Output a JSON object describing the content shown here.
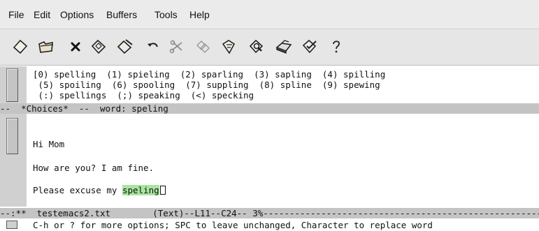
{
  "menubar": {
    "items": [
      "File",
      "Edit",
      "Options",
      "Buffers",
      "Tools",
      "Help"
    ]
  },
  "toolbar": {
    "icons": [
      "new-file-icon",
      "open-folder-icon",
      "close-icon",
      "save-icon",
      "save-as-icon",
      "undo-icon",
      "cut-icon",
      "copy-icon",
      "paste-icon",
      "search-icon",
      "print-icon",
      "spell-check-icon",
      "help-icon"
    ]
  },
  "choices": {
    "lines": [
      "[0) spelling  (1) spieling  (2) sparling  (3) sapling  (4) spilling",
      " (5) spoiling  (6) spooling  (7) suppling  (8) spline  (9) spewing",
      " (:) spellings  (;) speaking  (<) specking"
    ],
    "modeline": "--  *Choices*  --  word: speling"
  },
  "editor": {
    "lines": [
      "",
      "Hi Mom",
      "",
      "How are you? I am fine.",
      ""
    ],
    "last_line_prefix": "Please excuse my ",
    "misspelled_word": "speling",
    "modeline": "--:**  testemacs2.txt        (Text)--L11--C24-- 3%----------------------------------------------------------------"
  },
  "echo_area": {
    "text": "C-h or ? for more options; SPC to leave unchanged, Character to replace word"
  },
  "colors": {
    "highlight": "#a8e6a0",
    "modeline_bg": "#c4c4c4"
  }
}
